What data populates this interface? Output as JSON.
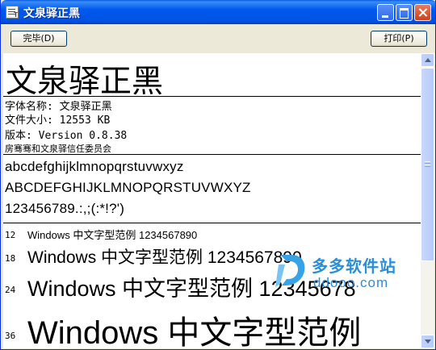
{
  "window": {
    "title": "文泉驿正黑"
  },
  "toolbar": {
    "done_label": "完毕(D)",
    "print_label": "打印(P)"
  },
  "preview": {
    "font_name_large": "文泉驿正黑",
    "info_lines": [
      "字体名称: 文泉驿正黑",
      "文件大小: 12553 KB",
      "版本: Version 0.8.38",
      "房骞骞和文泉驿信任委员会"
    ],
    "alphabet_lines": [
      "abcdefghijklmnopqrstuvwxyz",
      "ABCDEFGHIJKLMNOPQRSTUVWXYZ",
      "123456789.:,;(:*!?')"
    ],
    "size_samples": [
      {
        "size_label": "12",
        "text": "Windows 中文字型范例 1234567890"
      },
      {
        "size_label": "18",
        "text": "Windows 中文字型范例 1234567890"
      },
      {
        "size_label": "24",
        "text": "Windows 中文字型范例 12345678"
      },
      {
        "size_label": "36",
        "text": "Windows 中文字型范例"
      }
    ]
  },
  "watermark": {
    "name_cn": "多多软件站",
    "domain": "ddooo.com"
  },
  "colors": {
    "title_bar": "#0058ee",
    "window_face": "#ece9d8",
    "watermark": "#2a8fd6"
  },
  "icons": [
    "document-font-icon",
    "minimize-icon",
    "maximize-icon",
    "close-icon",
    "scroll-up-icon",
    "scroll-down-icon",
    "watermark-logo-icon"
  ]
}
